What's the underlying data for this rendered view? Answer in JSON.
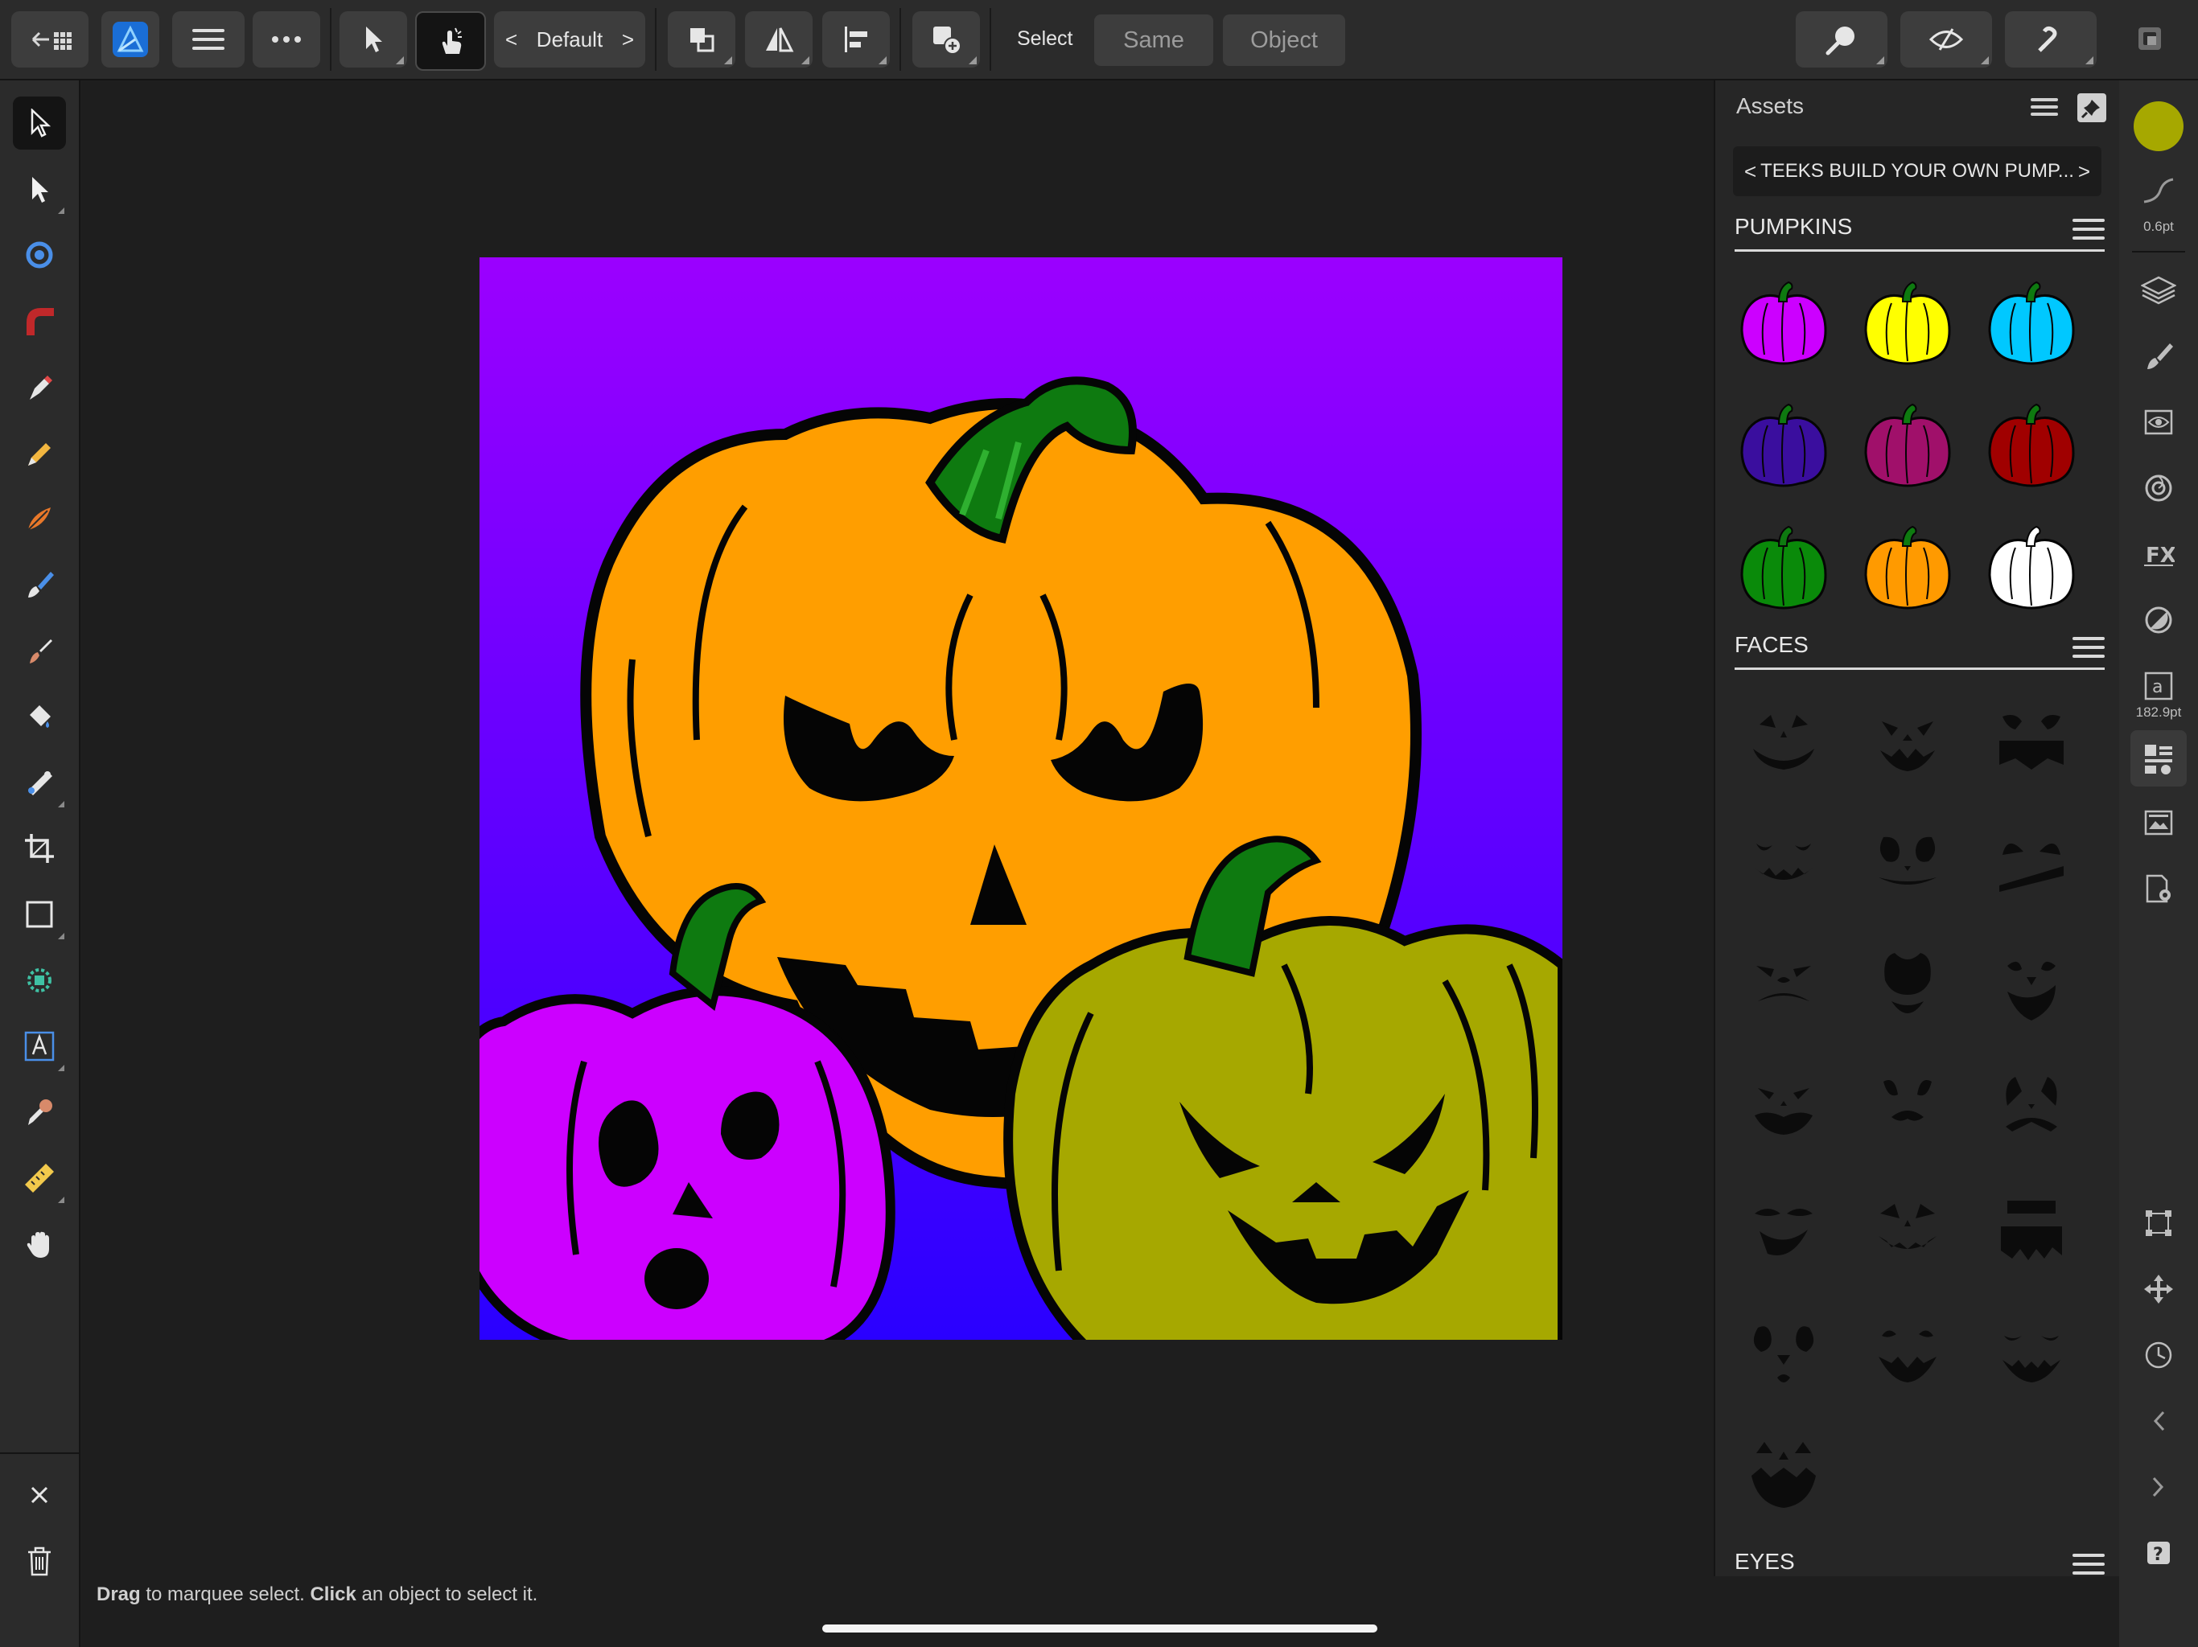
{
  "toolbar": {
    "persona_label": "Default",
    "select_label": "Select",
    "same_label": "Same",
    "object_label": "Object"
  },
  "assets": {
    "title": "Assets",
    "collection": "TEEKS BUILD YOUR OWN PUMP...",
    "categories": [
      {
        "name": "PUMPKINS"
      },
      {
        "name": "FACES"
      },
      {
        "name": "EYES"
      }
    ],
    "pumpkin_colors": [
      "#cc00ff",
      "#ffff00",
      "#00c8ff",
      "#3a0e9e",
      "#a0106a",
      "#a00000",
      "#0a8a0a",
      "#ff9a00",
      "#ffffff"
    ]
  },
  "studio": {
    "fill_color": "#a6a800",
    "stroke_width": "0.6pt",
    "font_size": "182.9pt"
  },
  "status": {
    "drag": "Drag",
    "drag_text": " to marquee select. ",
    "click": "Click",
    "click_text": " an object to select it."
  },
  "artwork": {
    "background_gradient": [
      "#9b00ff",
      "#2a00ff"
    ],
    "big_pumpkin_color": "#ff9e00",
    "left_pumpkin_color": "#cc00ff",
    "right_pumpkin_color": "#a6a800",
    "stem_color": "#0e7a10"
  }
}
